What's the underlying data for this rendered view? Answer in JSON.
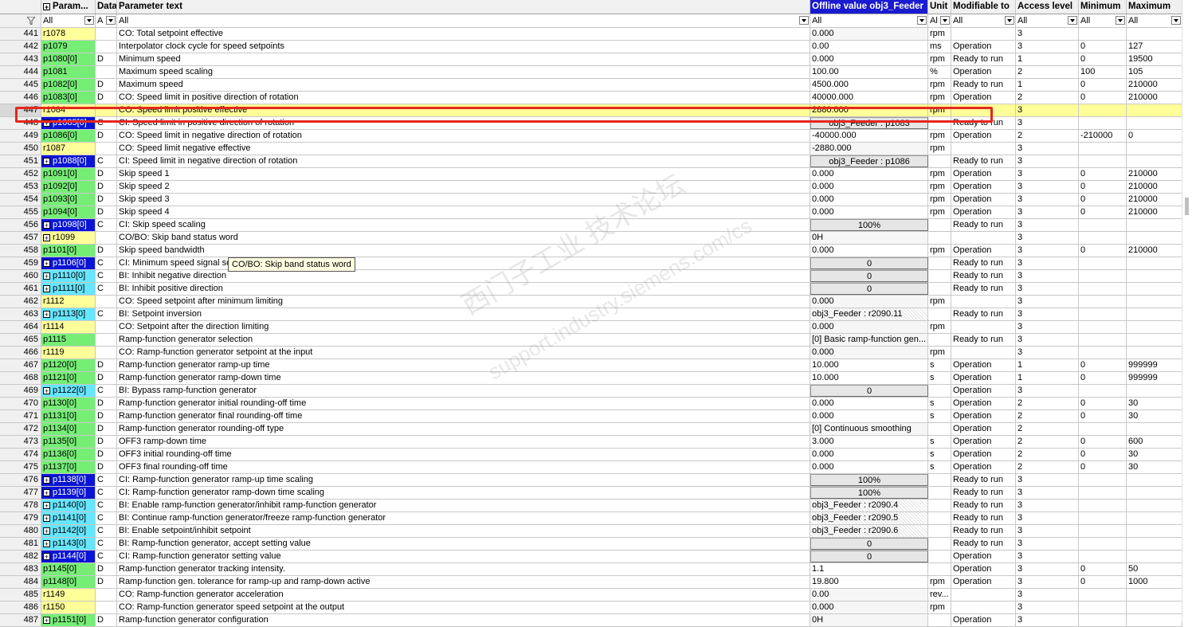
{
  "columns": {
    "param": "Param...",
    "data": "Data",
    "text": "Parameter text",
    "offline": "Offline value obj3_Feeder",
    "unit": "Unit",
    "modifiable": "Modifiable to",
    "access": "Access level",
    "minimum": "Minimum",
    "maximum": "Maximum"
  },
  "filters": {
    "param": "All",
    "data": "A",
    "text": "All",
    "offline": "All",
    "unit": "Al",
    "modifiable": "All",
    "access": "All",
    "minimum": "All",
    "maximum": "All"
  },
  "tooltip": "CO/BO: Skip band status word",
  "watermark": {
    "line1": "西门子工业 技术论坛",
    "line2": "support.industry.siemens.com/cs"
  },
  "colors": {
    "selected_row": "#ffff99",
    "highlight_box": "#e8261b",
    "header_active": "#1a1ad0"
  },
  "rows": [
    {
      "idx": "441",
      "param": "r1078",
      "pc": "yellow",
      "exp": false,
      "data": "",
      "text": "CO: Total setpoint effective",
      "val": "0.000",
      "vt": "grey",
      "unit": "rpm",
      "mod": "",
      "acc": "3",
      "min": "",
      "max": ""
    },
    {
      "idx": "442",
      "param": "p1079",
      "pc": "green",
      "exp": false,
      "data": "",
      "text": "Interpolator clock cycle for speed setpoints",
      "val": "0.00",
      "vt": "white",
      "unit": "ms",
      "mod": "Operation",
      "acc": "3",
      "min": "0",
      "max": "127"
    },
    {
      "idx": "443",
      "param": "p1080[0]",
      "pc": "green",
      "exp": false,
      "data": "D",
      "text": "Minimum speed",
      "val": "0.000",
      "vt": "white",
      "unit": "rpm",
      "mod": "Ready to run",
      "acc": "1",
      "min": "0",
      "max": "19500"
    },
    {
      "idx": "444",
      "param": "p1081",
      "pc": "green",
      "exp": false,
      "data": "",
      "text": "Maximum speed scaling",
      "val": "100.00",
      "vt": "white",
      "unit": "%",
      "mod": "Operation",
      "acc": "2",
      "min": "100",
      "max": "105"
    },
    {
      "idx": "445",
      "param": "p1082[0]",
      "pc": "green",
      "exp": false,
      "data": "D",
      "text": "Maximum speed",
      "val": "4500.000",
      "vt": "white",
      "unit": "rpm",
      "mod": "Ready to run",
      "acc": "1",
      "min": "0",
      "max": "210000"
    },
    {
      "idx": "446",
      "param": "p1083[0]",
      "pc": "green",
      "exp": false,
      "data": "D",
      "text": "CO: Speed limit in positive direction of rotation",
      "val": "40000.000",
      "vt": "white",
      "unit": "rpm",
      "mod": "Operation",
      "acc": "2",
      "min": "0",
      "max": "210000"
    },
    {
      "idx": "447",
      "param": "r1084",
      "pc": "white",
      "exp": false,
      "data": "",
      "text": "CO: Speed limit positive effective",
      "val": "2880.000",
      "vt": "grey",
      "unit": "rpm",
      "mod": "",
      "acc": "3",
      "min": "",
      "max": "",
      "sel": true
    },
    {
      "idx": "448",
      "param": "p1085[0]",
      "pc": "blue",
      "exp": true,
      "data": "C",
      "text": "CI: Speed limit in positive direction of rotation",
      "val": "obj3_Feeder : p1083",
      "vt": "btn",
      "unit": "",
      "mod": "Ready to run",
      "acc": "3",
      "min": "",
      "max": ""
    },
    {
      "idx": "449",
      "param": "p1086[0]",
      "pc": "green",
      "exp": false,
      "data": "D",
      "text": "CO: Speed limit in negative direction of rotation",
      "val": "-40000.000",
      "vt": "white",
      "unit": "rpm",
      "mod": "Operation",
      "acc": "2",
      "min": "-210000",
      "max": "0"
    },
    {
      "idx": "450",
      "param": "r1087",
      "pc": "yellow",
      "exp": false,
      "data": "",
      "text": "CO: Speed limit negative effective",
      "val": "-2880.000",
      "vt": "grey",
      "unit": "rpm",
      "mod": "",
      "acc": "3",
      "min": "",
      "max": ""
    },
    {
      "idx": "451",
      "param": "p1088[0]",
      "pc": "blue",
      "exp": true,
      "data": "C",
      "text": "CI: Speed limit in negative direction of rotation",
      "val": "obj3_Feeder : p1086",
      "vt": "btn",
      "unit": "",
      "mod": "Ready to run",
      "acc": "3",
      "min": "",
      "max": ""
    },
    {
      "idx": "452",
      "param": "p1091[0]",
      "pc": "green",
      "exp": false,
      "data": "D",
      "text": "Skip speed 1",
      "val": "0.000",
      "vt": "white",
      "unit": "rpm",
      "mod": "Operation",
      "acc": "3",
      "min": "0",
      "max": "210000"
    },
    {
      "idx": "453",
      "param": "p1092[0]",
      "pc": "green",
      "exp": false,
      "data": "D",
      "text": "Skip speed 2",
      "val": "0.000",
      "vt": "white",
      "unit": "rpm",
      "mod": "Operation",
      "acc": "3",
      "min": "0",
      "max": "210000"
    },
    {
      "idx": "454",
      "param": "p1093[0]",
      "pc": "green",
      "exp": false,
      "data": "D",
      "text": "Skip speed 3",
      "val": "0.000",
      "vt": "white",
      "unit": "rpm",
      "mod": "Operation",
      "acc": "3",
      "min": "0",
      "max": "210000"
    },
    {
      "idx": "455",
      "param": "p1094[0]",
      "pc": "green",
      "exp": false,
      "data": "D",
      "text": "Skip speed 4",
      "val": "0.000",
      "vt": "white",
      "unit": "rpm",
      "mod": "Operation",
      "acc": "3",
      "min": "0",
      "max": "210000"
    },
    {
      "idx": "456",
      "param": "p1098[0]",
      "pc": "blue",
      "exp": true,
      "data": "C",
      "text": "CI: Skip speed scaling",
      "val": "100%",
      "vt": "btn",
      "unit": "",
      "mod": "Ready to run",
      "acc": "3",
      "min": "",
      "max": ""
    },
    {
      "idx": "457",
      "param": "r1099",
      "pc": "yellow",
      "exp": true,
      "data": "",
      "text": "CO/BO: Skip band status word",
      "val": "0H",
      "vt": "grey",
      "unit": "",
      "mod": "",
      "acc": "3",
      "min": "",
      "max": ""
    },
    {
      "idx": "458",
      "param": "p1101[0]",
      "pc": "green",
      "exp": false,
      "data": "D",
      "text": "Skip speed bandwidth",
      "val": "0.000",
      "vt": "white",
      "unit": "rpm",
      "mod": "Operation",
      "acc": "3",
      "min": "0",
      "max": "210000"
    },
    {
      "idx": "459",
      "param": "p1106[0]",
      "pc": "blue",
      "exp": true,
      "data": "C",
      "text": "CI: Minimum speed signal sou",
      "val": "0",
      "vt": "btn",
      "unit": "",
      "mod": "Ready to run",
      "acc": "3",
      "min": "",
      "max": ""
    },
    {
      "idx": "460",
      "param": "p1110[0]",
      "pc": "cyan",
      "exp": true,
      "data": "C",
      "text": "BI: Inhibit negative direction",
      "val": "0",
      "vt": "btn",
      "unit": "",
      "mod": "Ready to run",
      "acc": "3",
      "min": "",
      "max": ""
    },
    {
      "idx": "461",
      "param": "p1111[0]",
      "pc": "cyan",
      "exp": true,
      "data": "C",
      "text": "BI: Inhibit positive direction",
      "val": "0",
      "vt": "btn",
      "unit": "",
      "mod": "Ready to run",
      "acc": "3",
      "min": "",
      "max": ""
    },
    {
      "idx": "462",
      "param": "r1112",
      "pc": "yellow",
      "exp": false,
      "data": "",
      "text": "CO: Speed setpoint after minimum limiting",
      "val": "0.000",
      "vt": "grey",
      "unit": "rpm",
      "mod": "",
      "acc": "3",
      "min": "",
      "max": ""
    },
    {
      "idx": "463",
      "param": "p1113[0]",
      "pc": "cyan",
      "exp": true,
      "data": "C",
      "text": "BI: Setpoint inversion",
      "val": "obj3_Feeder : r2090.11",
      "vt": "hatch",
      "unit": "",
      "mod": "Ready to run",
      "acc": "3",
      "min": "",
      "max": ""
    },
    {
      "idx": "464",
      "param": "r1114",
      "pc": "yellow",
      "exp": false,
      "data": "",
      "text": "CO: Setpoint after the direction limiting",
      "val": "0.000",
      "vt": "grey",
      "unit": "rpm",
      "mod": "",
      "acc": "3",
      "min": "",
      "max": ""
    },
    {
      "idx": "465",
      "param": "p1115",
      "pc": "green",
      "exp": false,
      "data": "",
      "text": "Ramp-function generator selection",
      "val": "[0] Basic ramp-function gen...",
      "vt": "grey",
      "unit": "",
      "mod": "Ready to run",
      "acc": "3",
      "min": "",
      "max": ""
    },
    {
      "idx": "466",
      "param": "r1119",
      "pc": "yellow",
      "exp": false,
      "data": "",
      "text": "CO: Ramp-function generator setpoint at the input",
      "val": "0.000",
      "vt": "grey",
      "unit": "rpm",
      "mod": "",
      "acc": "3",
      "min": "",
      "max": ""
    },
    {
      "idx": "467",
      "param": "p1120[0]",
      "pc": "green",
      "exp": false,
      "data": "D",
      "text": "Ramp-function generator ramp-up time",
      "val": "10.000",
      "vt": "white",
      "unit": "s",
      "mod": "Operation",
      "acc": "1",
      "min": "0",
      "max": "999999"
    },
    {
      "idx": "468",
      "param": "p1121[0]",
      "pc": "green",
      "exp": false,
      "data": "D",
      "text": "Ramp-function generator ramp-down time",
      "val": "10.000",
      "vt": "white",
      "unit": "s",
      "mod": "Operation",
      "acc": "1",
      "min": "0",
      "max": "999999"
    },
    {
      "idx": "469",
      "param": "p1122[0]",
      "pc": "cyan",
      "exp": true,
      "data": "C",
      "text": "BI: Bypass ramp-function generator",
      "val": "0",
      "vt": "btn",
      "unit": "",
      "mod": "Operation",
      "acc": "3",
      "min": "",
      "max": ""
    },
    {
      "idx": "470",
      "param": "p1130[0]",
      "pc": "green",
      "exp": false,
      "data": "D",
      "text": "Ramp-function generator initial rounding-off time",
      "val": "0.000",
      "vt": "white",
      "unit": "s",
      "mod": "Operation",
      "acc": "2",
      "min": "0",
      "max": "30"
    },
    {
      "idx": "471",
      "param": "p1131[0]",
      "pc": "green",
      "exp": false,
      "data": "D",
      "text": "Ramp-function generator final rounding-off time",
      "val": "0.000",
      "vt": "white",
      "unit": "s",
      "mod": "Operation",
      "acc": "2",
      "min": "0",
      "max": "30"
    },
    {
      "idx": "472",
      "param": "p1134[0]",
      "pc": "green",
      "exp": false,
      "data": "D",
      "text": "Ramp-function generator rounding-off type",
      "val": "[0] Continuous smoothing",
      "vt": "grey",
      "unit": "",
      "mod": "Operation",
      "acc": "2",
      "min": "",
      "max": ""
    },
    {
      "idx": "473",
      "param": "p1135[0]",
      "pc": "green",
      "exp": false,
      "data": "D",
      "text": "OFF3 ramp-down time",
      "val": "3.000",
      "vt": "white",
      "unit": "s",
      "mod": "Operation",
      "acc": "2",
      "min": "0",
      "max": "600"
    },
    {
      "idx": "474",
      "param": "p1136[0]",
      "pc": "green",
      "exp": false,
      "data": "D",
      "text": "OFF3 initial rounding-off time",
      "val": "0.000",
      "vt": "white",
      "unit": "s",
      "mod": "Operation",
      "acc": "2",
      "min": "0",
      "max": "30"
    },
    {
      "idx": "475",
      "param": "p1137[0]",
      "pc": "green",
      "exp": false,
      "data": "D",
      "text": "OFF3 final rounding-off time",
      "val": "0.000",
      "vt": "white",
      "unit": "s",
      "mod": "Operation",
      "acc": "2",
      "min": "0",
      "max": "30"
    },
    {
      "idx": "476",
      "param": "p1138[0]",
      "pc": "blue",
      "exp": true,
      "data": "C",
      "text": "CI: Ramp-function generator ramp-up time scaling",
      "val": "100%",
      "vt": "btn",
      "unit": "",
      "mod": "Ready to run",
      "acc": "3",
      "min": "",
      "max": ""
    },
    {
      "idx": "477",
      "param": "p1139[0]",
      "pc": "blue",
      "exp": true,
      "data": "C",
      "text": "CI: Ramp-function generator ramp-down time scaling",
      "val": "100%",
      "vt": "btn",
      "unit": "",
      "mod": "Ready to run",
      "acc": "3",
      "min": "",
      "max": ""
    },
    {
      "idx": "478",
      "param": "p1140[0]",
      "pc": "cyan",
      "exp": true,
      "data": "C",
      "text": "BI: Enable ramp-function generator/inhibit ramp-function generator",
      "val": "obj3_Feeder : r2090.4",
      "vt": "hatch",
      "unit": "",
      "mod": "Ready to run",
      "acc": "3",
      "min": "",
      "max": ""
    },
    {
      "idx": "479",
      "param": "p1141[0]",
      "pc": "cyan",
      "exp": true,
      "data": "C",
      "text": "BI: Continue ramp-function generator/freeze ramp-function generator",
      "val": "obj3_Feeder : r2090.5",
      "vt": "hatch",
      "unit": "",
      "mod": "Ready to run",
      "acc": "3",
      "min": "",
      "max": ""
    },
    {
      "idx": "480",
      "param": "p1142[0]",
      "pc": "cyan",
      "exp": true,
      "data": "C",
      "text": "BI: Enable setpoint/inhibit setpoint",
      "val": "obj3_Feeder : r2090.6",
      "vt": "hatch",
      "unit": "",
      "mod": "Ready to run",
      "acc": "3",
      "min": "",
      "max": ""
    },
    {
      "idx": "481",
      "param": "p1143[0]",
      "pc": "cyan",
      "exp": true,
      "data": "C",
      "text": "BI: Ramp-function generator, accept setting value",
      "val": "0",
      "vt": "btn",
      "unit": "",
      "mod": "Ready to run",
      "acc": "3",
      "min": "",
      "max": ""
    },
    {
      "idx": "482",
      "param": "p1144[0]",
      "pc": "blue",
      "exp": true,
      "data": "C",
      "text": "CI: Ramp-function generator setting value",
      "val": "0",
      "vt": "btn",
      "unit": "",
      "mod": "Operation",
      "acc": "3",
      "min": "",
      "max": ""
    },
    {
      "idx": "483",
      "param": "p1145[0]",
      "pc": "green",
      "exp": false,
      "data": "D",
      "text": "Ramp-function generator tracking intensity.",
      "val": "1.1",
      "vt": "white",
      "unit": "",
      "mod": "Operation",
      "acc": "3",
      "min": "0",
      "max": "50"
    },
    {
      "idx": "484",
      "param": "p1148[0]",
      "pc": "green",
      "exp": false,
      "data": "D",
      "text": "Ramp-function gen. tolerance for ramp-up and ramp-down active",
      "val": "19.800",
      "vt": "white",
      "unit": "rpm",
      "mod": "Operation",
      "acc": "3",
      "min": "0",
      "max": "1000"
    },
    {
      "idx": "485",
      "param": "r1149",
      "pc": "yellow",
      "exp": false,
      "data": "",
      "text": "CO: Ramp-function generator acceleration",
      "val": "0.00",
      "vt": "grey",
      "unit": "rev...",
      "mod": "",
      "acc": "3",
      "min": "",
      "max": ""
    },
    {
      "idx": "486",
      "param": "r1150",
      "pc": "yellow",
      "exp": false,
      "data": "",
      "text": "CO: Ramp-function generator speed setpoint at the output",
      "val": "0.000",
      "vt": "grey",
      "unit": "rpm",
      "mod": "",
      "acc": "3",
      "min": "",
      "max": ""
    },
    {
      "idx": "487",
      "param": "p1151[0]",
      "pc": "green",
      "exp": true,
      "data": "D",
      "text": "Ramp-function generator configuration",
      "val": "0H",
      "vt": "grey",
      "unit": "",
      "mod": "Operation",
      "acc": "3",
      "min": "",
      "max": ""
    }
  ]
}
